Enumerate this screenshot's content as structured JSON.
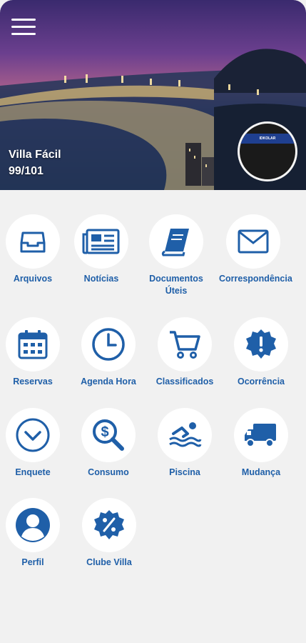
{
  "header": {
    "menu_icon": "hamburger-menu-icon",
    "condo_name": "Villa Fácil",
    "unit": "99/101",
    "avatar_banner": "IDKOLAR"
  },
  "colors": {
    "accent": "#1f5fa8",
    "background": "#f1f1f1",
    "tile": "#ffffff"
  },
  "menu": [
    {
      "label": "Arquivos",
      "icon": "inbox-icon"
    },
    {
      "label": "Notícias",
      "icon": "newspaper-icon"
    },
    {
      "label": "Documentos\nÚteis",
      "icon": "book-icon"
    },
    {
      "label": "Correspondência",
      "icon": "envelope-icon"
    },
    {
      "label": "Reservas",
      "icon": "calendar-icon"
    },
    {
      "label": "Agenda Hora",
      "icon": "clock-icon"
    },
    {
      "label": "Classificados",
      "icon": "cart-icon"
    },
    {
      "label": "Ocorrência",
      "icon": "alert-badge-icon"
    },
    {
      "label": "Enquete",
      "icon": "check-circle-icon"
    },
    {
      "label": "Consumo",
      "icon": "search-dollar-icon"
    },
    {
      "label": "Piscina",
      "icon": "swimmer-icon"
    },
    {
      "label": "Mudança",
      "icon": "truck-icon"
    },
    {
      "label": "Perfil",
      "icon": "user-icon"
    },
    {
      "label": "Clube Villa",
      "icon": "percent-badge-icon"
    }
  ]
}
